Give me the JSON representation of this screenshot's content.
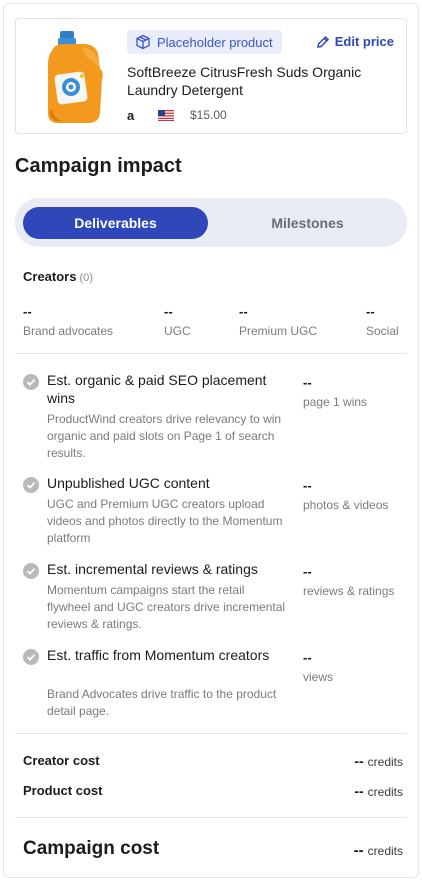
{
  "product": {
    "tag_label": "Placeholder product",
    "edit_price_label": "Edit price",
    "name": "SoftBreeze CitrusFresh Suds Organic Laundry Detergent",
    "price": "$15.00",
    "marketplace_icon": "amazon-icon",
    "country_icon": "us-flag-icon"
  },
  "campaign": {
    "title": "Campaign impact",
    "tabs": {
      "active": "Deliverables",
      "inactive": "Milestones"
    },
    "creators": {
      "label": "Creators",
      "count": "(0)",
      "stats": [
        {
          "value": "--",
          "label": "Brand advocates"
        },
        {
          "value": "--",
          "label": "UGC"
        },
        {
          "value": "--",
          "label": "Premium UGC"
        },
        {
          "value": "--",
          "label": "Social"
        }
      ]
    },
    "items": [
      {
        "title": "Est. organic & paid SEO placement wins",
        "desc": "ProductWind creators drive relevancy to win organic and paid slots on Page 1 of search results.",
        "value": "--",
        "unit": "page 1 wins"
      },
      {
        "title": "Unpublished UGC content",
        "desc": "UGC and Premium UGC creators upload videos and photos directly to the Momentum platform",
        "value": "--",
        "unit": "photos & videos"
      },
      {
        "title": "Est. incremental reviews & ratings",
        "desc": "Momentum campaigns start the retail flywheel and UGC creators drive incremental reviews & ratings.",
        "value": "--",
        "unit": "reviews & ratings"
      },
      {
        "title": "Est. traffic from Momentum creators",
        "desc": "Brand Advocates drive traffic to the product detail page.",
        "value": "--",
        "unit": "views"
      }
    ],
    "costs": [
      {
        "label": "Creator cost",
        "value": "--",
        "unit": "credits"
      },
      {
        "label": "Product cost",
        "value": "--",
        "unit": "credits"
      }
    ],
    "total": {
      "label": "Campaign cost",
      "value": "--",
      "unit": "credits"
    }
  },
  "colors": {
    "accent": "#2f47b8",
    "tag_bg": "#e8ecfb",
    "toggle_bg": "#e9ecf5",
    "check_gray": "#b9b9bd"
  }
}
